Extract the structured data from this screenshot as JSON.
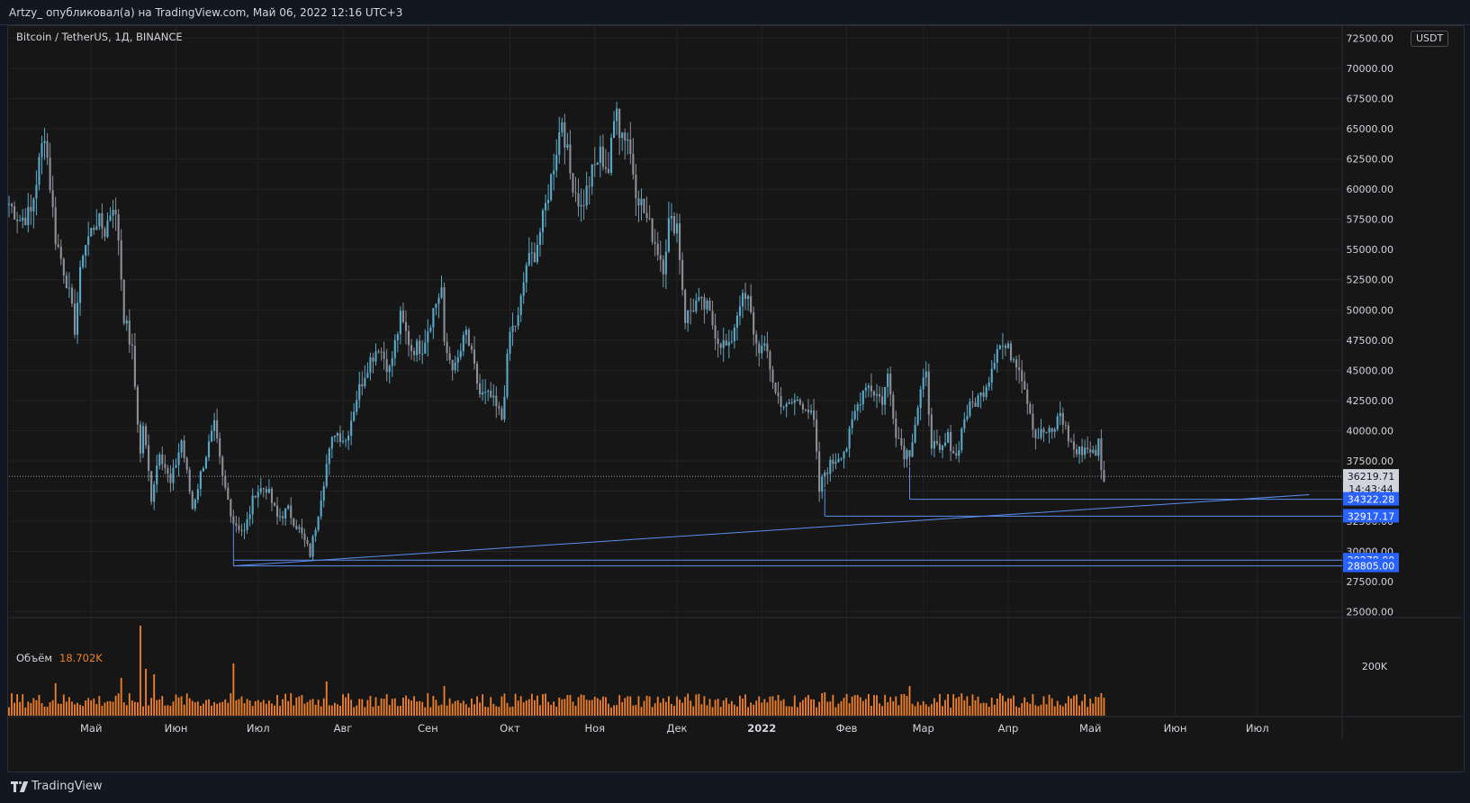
{
  "header": {
    "published_by": "Artzy_ опубликовал(а) на TradingView.com, Май 06, 2022 12:16 UTC+3"
  },
  "chart": {
    "symbol_label": "Bitcoin / TetherUS, 1Д, BINANCE",
    "currency_badge": "USDT",
    "volume_label": "Объём",
    "volume_value": "18.702K",
    "volume_axis_label": "200K",
    "countdown": "14:43:44",
    "brand": "TradingView"
  },
  "chart_data": {
    "type": "candlestick",
    "price_axis_ticks": [
      25000,
      27500,
      30000,
      32500,
      35000,
      37500,
      40000,
      42500,
      45000,
      47500,
      50000,
      52500,
      55000,
      57500,
      60000,
      62500,
      65000,
      67500,
      70000,
      72500
    ],
    "price_axis_tick_labels": [
      "25000.00",
      "27500.00",
      "30000.00",
      "32500.00",
      "35000.00",
      "37500.00",
      "40000.00",
      "42500.00",
      "45000.00",
      "47500.00",
      "50000.00",
      "52500.00",
      "55000.00",
      "57500.00",
      "60000.00",
      "62500.00",
      "65000.00",
      "67500.00",
      "70000.00",
      "72500.00"
    ],
    "ylim": [
      24600,
      73500
    ],
    "x_tick_labels": [
      "Май",
      "Июн",
      "Июл",
      "Авг",
      "Сен",
      "Окт",
      "Ноя",
      "Дек",
      "2022",
      "Фев",
      "Мар",
      "Апр",
      "Май",
      "Июн",
      "Июл"
    ],
    "x_tick_dates": [
      "2021-05-01",
      "2021-06-01",
      "2021-07-01",
      "2021-08-01",
      "2021-09-01",
      "2021-10-01",
      "2021-11-01",
      "2021-12-01",
      "2022-01-01",
      "2022-02-01",
      "2022-03-01",
      "2022-04-01",
      "2022-05-01",
      "2022-06-01",
      "2022-07-01"
    ],
    "x_range": [
      "2021-04-01",
      "2022-08-01"
    ],
    "last_price": 36219.71,
    "price_labels": [
      {
        "value": 36219.71,
        "label": "36219.71",
        "color": "#d1d4dc"
      },
      {
        "value": 34322.28,
        "label": "34322.28",
        "color": "#2962ff"
      },
      {
        "value": 32917.17,
        "label": "32917.17",
        "color": "#2962ff"
      },
      {
        "value": 29278.0,
        "label": "29278.00",
        "color": "#2962ff"
      },
      {
        "value": 28805.0,
        "label": "28805.00",
        "color": "#2962ff"
      }
    ],
    "horizontal_levels": [
      {
        "from": "2022-02-24",
        "price": 34322.28
      },
      {
        "from": "2022-01-24",
        "price": 32917.17
      },
      {
        "from": "2021-06-22",
        "price": 29278.0
      },
      {
        "from": "2021-06-22",
        "price": 28805.0
      }
    ],
    "trendline": {
      "from": [
        "2021-06-22",
        28805
      ],
      "to": [
        "2022-07-20",
        34700
      ]
    },
    "price_path": [
      [
        "2021-04-01",
        58800
      ],
      [
        "2021-04-05",
        57500
      ],
      [
        "2021-04-09",
        58000
      ],
      [
        "2021-04-13",
        63500
      ],
      [
        "2021-04-14",
        64800
      ],
      [
        "2021-04-18",
        56000
      ],
      [
        "2021-04-22",
        52500
      ],
      [
        "2021-04-25",
        48500
      ],
      [
        "2021-04-28",
        55000
      ],
      [
        "2021-05-03",
        57500
      ],
      [
        "2021-05-06",
        56500
      ],
      [
        "2021-05-09",
        58900
      ],
      [
        "2021-05-11",
        56000
      ],
      [
        "2021-05-13",
        49500
      ],
      [
        "2021-05-16",
        46500
      ],
      [
        "2021-05-19",
        38000
      ],
      [
        "2021-05-20",
        40500
      ],
      [
        "2021-05-23",
        34500
      ],
      [
        "2021-05-26",
        38500
      ],
      [
        "2021-05-30",
        35500
      ],
      [
        "2021-06-03",
        39200
      ],
      [
        "2021-06-07",
        33600
      ],
      [
        "2021-06-11",
        37300
      ],
      [
        "2021-06-15",
        40300
      ],
      [
        "2021-06-18",
        36000
      ],
      [
        "2021-06-22",
        32500
      ],
      [
        "2021-06-26",
        31600
      ],
      [
        "2021-06-30",
        35000
      ],
      [
        "2021-07-04",
        35300
      ],
      [
        "2021-07-08",
        32800
      ],
      [
        "2021-07-12",
        33400
      ],
      [
        "2021-07-16",
        31800
      ],
      [
        "2021-07-20",
        29800
      ],
      [
        "2021-07-22",
        32100
      ],
      [
        "2021-07-26",
        37200
      ],
      [
        "2021-07-29",
        40000
      ],
      [
        "2021-08-02",
        39200
      ],
      [
        "2021-08-06",
        42800
      ],
      [
        "2021-08-10",
        45500
      ],
      [
        "2021-08-14",
        47100
      ],
      [
        "2021-08-18",
        45000
      ],
      [
        "2021-08-22",
        49300
      ],
      [
        "2021-08-26",
        46800
      ],
      [
        "2021-08-30",
        47000
      ],
      [
        "2021-09-03",
        50000
      ],
      [
        "2021-09-06",
        51800
      ],
      [
        "2021-09-07",
        46800
      ],
      [
        "2021-09-11",
        45100
      ],
      [
        "2021-09-15",
        48100
      ],
      [
        "2021-09-20",
        43000
      ],
      [
        "2021-09-24",
        42700
      ],
      [
        "2021-09-28",
        41000
      ],
      [
        "2021-10-01",
        48100
      ],
      [
        "2021-10-04",
        49200
      ],
      [
        "2021-10-07",
        53800
      ],
      [
        "2021-10-10",
        54700
      ],
      [
        "2021-10-13",
        57400
      ],
      [
        "2021-10-16",
        60900
      ],
      [
        "2021-10-20",
        65900
      ],
      [
        "2021-10-23",
        61300
      ],
      [
        "2021-10-27",
        58400
      ],
      [
        "2021-10-31",
        61300
      ],
      [
        "2021-11-03",
        62900
      ],
      [
        "2021-11-06",
        61500
      ],
      [
        "2021-11-09",
        67500
      ],
      [
        "2021-11-10",
        64900
      ],
      [
        "2021-11-13",
        64300
      ],
      [
        "2021-11-16",
        60100
      ],
      [
        "2021-11-19",
        58100
      ],
      [
        "2021-11-22",
        56300
      ],
      [
        "2021-11-26",
        53700
      ],
      [
        "2021-11-28",
        57200
      ],
      [
        "2021-12-01",
        57100
      ],
      [
        "2021-12-04",
        49300
      ],
      [
        "2021-12-08",
        50600
      ],
      [
        "2021-12-12",
        50100
      ],
      [
        "2021-12-16",
        47600
      ],
      [
        "2021-12-20",
        46700
      ],
      [
        "2021-12-24",
        50800
      ],
      [
        "2021-12-27",
        50700
      ],
      [
        "2021-12-30",
        47100
      ],
      [
        "2022-01-03",
        46400
      ],
      [
        "2022-01-06",
        43100
      ],
      [
        "2022-01-10",
        41800
      ],
      [
        "2022-01-13",
        42500
      ],
      [
        "2022-01-17",
        42200
      ],
      [
        "2022-01-20",
        40600
      ],
      [
        "2022-01-22",
        35000
      ],
      [
        "2022-01-24",
        36600
      ],
      [
        "2022-01-28",
        37700
      ],
      [
        "2022-02-01",
        38700
      ],
      [
        "2022-02-04",
        41500
      ],
      [
        "2022-02-08",
        44000
      ],
      [
        "2022-02-10",
        43500
      ],
      [
        "2022-02-14",
        42500
      ],
      [
        "2022-02-16",
        44500
      ],
      [
        "2022-02-19",
        40000
      ],
      [
        "2022-02-22",
        38200
      ],
      [
        "2022-02-24",
        38300
      ],
      [
        "2022-02-28",
        43200
      ],
      [
        "2022-03-02",
        44400
      ],
      [
        "2022-03-04",
        39100
      ],
      [
        "2022-03-07",
        38000
      ],
      [
        "2022-03-10",
        39400
      ],
      [
        "2022-03-13",
        37800
      ],
      [
        "2022-03-16",
        41100
      ],
      [
        "2022-03-19",
        42200
      ],
      [
        "2022-03-22",
        42900
      ],
      [
        "2022-03-25",
        44500
      ],
      [
        "2022-03-28",
        47100
      ],
      [
        "2022-03-30",
        47000
      ],
      [
        "2022-04-02",
        46400
      ],
      [
        "2022-04-05",
        45500
      ],
      [
        "2022-04-08",
        42700
      ],
      [
        "2022-04-11",
        39500
      ],
      [
        "2022-04-14",
        39900
      ],
      [
        "2022-04-17",
        39700
      ],
      [
        "2022-04-20",
        41500
      ],
      [
        "2022-04-23",
        39400
      ],
      [
        "2022-04-26",
        38100
      ],
      [
        "2022-04-29",
        38600
      ],
      [
        "2022-05-01",
        38500
      ],
      [
        "2022-05-03",
        37700
      ],
      [
        "2022-05-04",
        39700
      ],
      [
        "2022-05-05",
        36500
      ],
      [
        "2022-05-06",
        36219.71
      ]
    ],
    "volume_spikes": [
      [
        "2021-05-19",
        1.0
      ],
      [
        "2021-05-21",
        0.52
      ],
      [
        "2021-05-24",
        0.46
      ],
      [
        "2021-06-22",
        0.58
      ],
      [
        "2021-05-12",
        0.42
      ],
      [
        "2021-04-18",
        0.36
      ],
      [
        "2021-07-26",
        0.38
      ],
      [
        "2021-09-07",
        0.33
      ],
      [
        "2022-01-24",
        0.26
      ],
      [
        "2022-02-24",
        0.33
      ],
      [
        "2022-05-05",
        0.25
      ]
    ],
    "volume_baseline": 0.2
  }
}
